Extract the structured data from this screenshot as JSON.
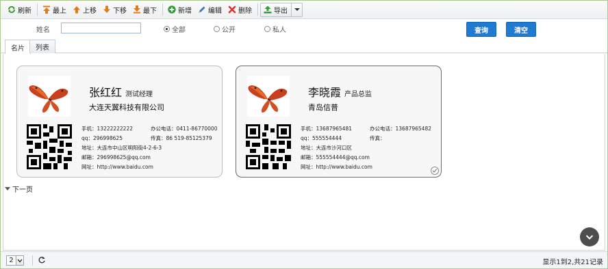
{
  "toolbar": {
    "refresh": "刷新",
    "top": "最上",
    "up": "上移",
    "down": "下移",
    "bottom": "最下",
    "add": "新增",
    "edit": "编辑",
    "delete": "删除",
    "export": "导出"
  },
  "search": {
    "name_label": "姓名",
    "name_value": "",
    "radios": [
      {
        "label": "全部",
        "checked": true
      },
      {
        "label": "公开",
        "checked": false
      },
      {
        "label": "私人",
        "checked": false
      }
    ],
    "query_button": "查询",
    "clear_button": "清空"
  },
  "tabs": [
    {
      "label": "名片",
      "active": true
    },
    {
      "label": "列表",
      "active": false
    }
  ],
  "cards": [
    {
      "name": "张红红",
      "title": "测试经理",
      "company": "大连天翼科技有限公司",
      "mobile": "手机：13222222222",
      "office_phone": "办公电话：0411-86770000",
      "qq": "qq：296998625",
      "fax": "传真：86 519-85125379",
      "address": "地址：大连市中山区明阳街4-2-6-3",
      "email": "邮箱：296998625@qq.com",
      "website": "网址：http://www.baidu.com"
    },
    {
      "name": "李晓霞",
      "title": "产品总监",
      "company": "青岛信普",
      "mobile": "手机：13687965481",
      "office_phone": "办公电话：13687965482",
      "qq": "qq：555554444",
      "fax": "传真：",
      "address": "地址：大连市沙河口区",
      "email": "邮箱：555554444@qq.com",
      "website": "网址：http://www.baidu.com"
    }
  ],
  "next_page": "下一页",
  "pager": {
    "page_size": "2",
    "summary": "显示1到2,共21记录"
  },
  "colors": {
    "accent_blue": "#1f7ad1",
    "frame_green": "#a8c98f"
  }
}
